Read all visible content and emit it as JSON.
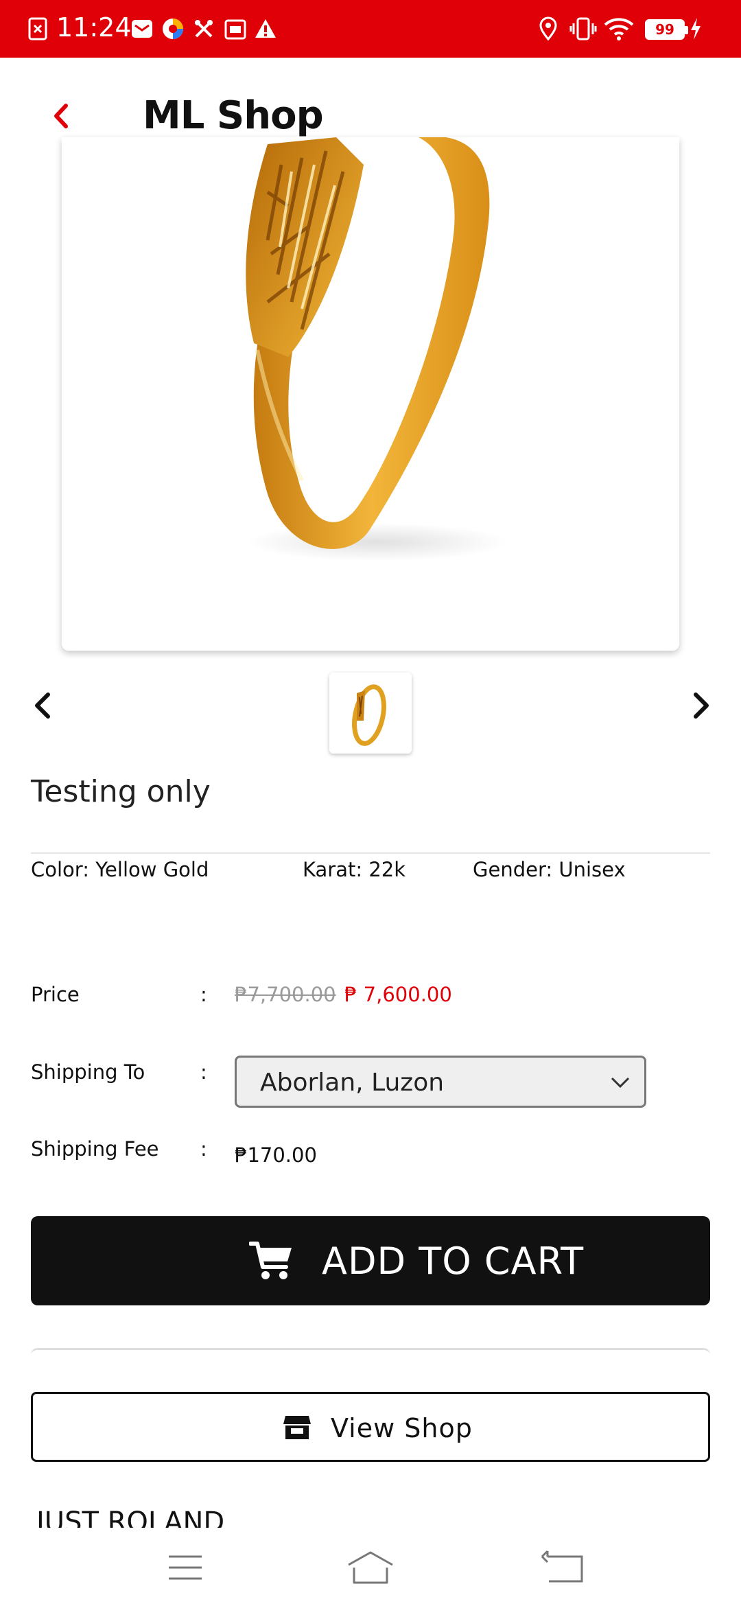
{
  "status_bar": {
    "time": "11:24",
    "battery": "99",
    "background": "#e00008"
  },
  "app_bar": {
    "title": "ML Shop",
    "back_icon": "chevron-left-icon"
  },
  "product": {
    "name": "Testing only",
    "image_count_shown": 1,
    "attributes": {
      "color": "Color: Yellow Gold",
      "karat": "Karat: 22k",
      "gender": "Gender: Unisex"
    }
  },
  "details": {
    "price_label": "Price",
    "colon": ":",
    "old_price": "₱7,700.00",
    "new_price": "₱ 7,600.00",
    "shipping_to_label": "Shipping To",
    "shipping_to_value": "Aborlan, Luzon",
    "shipping_fee_label": "Shipping Fee",
    "shipping_fee_value": "₱170.00"
  },
  "actions": {
    "add_to_cart": "ADD TO CART",
    "view_shop": "View Shop"
  },
  "shop": {
    "name": "JUST ROLAND"
  },
  "colors": {
    "accent": "#e00008",
    "button_dark": "#111111",
    "gold": "#e6a21c"
  }
}
